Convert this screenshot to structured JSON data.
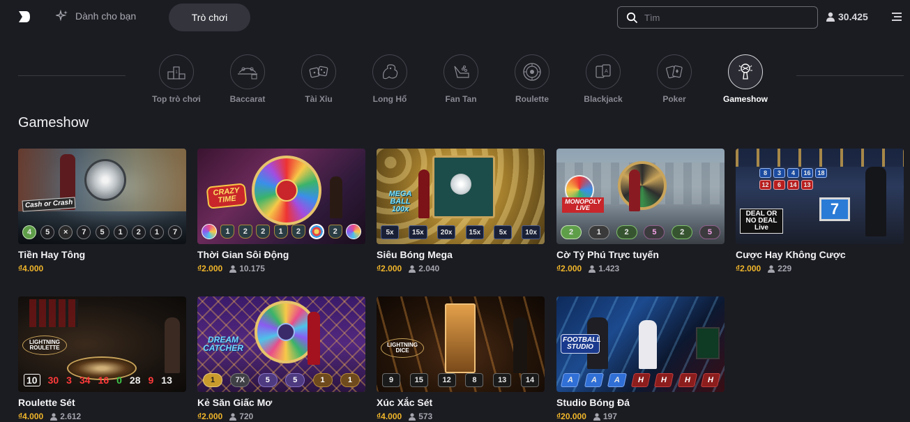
{
  "header": {
    "nav_for_you": "Dành cho bạn",
    "nav_games": "Trò chơi",
    "search_placeholder": "Tìm",
    "online_count": "30.425"
  },
  "categories": [
    {
      "label": "Top trò chơi",
      "icon": "podium-icon",
      "active": false
    },
    {
      "label": "Baccarat",
      "icon": "baccarat-table-icon",
      "active": false
    },
    {
      "label": "Tài Xỉu",
      "icon": "dice-icon",
      "active": false
    },
    {
      "label": "Long Hổ",
      "icon": "dragon-tiger-icon",
      "active": false
    },
    {
      "label": "Fan Tan",
      "icon": "fan-tan-hand-icon",
      "active": false
    },
    {
      "label": "Roulette",
      "icon": "roulette-wheel-icon",
      "active": false
    },
    {
      "label": "Blackjack",
      "icon": "blackjack-cards-icon",
      "active": false
    },
    {
      "label": "Poker",
      "icon": "poker-cards-icon",
      "active": false
    },
    {
      "label": "Gameshow",
      "icon": "microphone-icon",
      "active": true
    }
  ],
  "section_title": "Gameshow",
  "games": [
    {
      "name": "Tiền Hay Tông",
      "price": "₫4.000",
      "viewers": "",
      "logo_text": "Cash or Crash",
      "results": [
        "4",
        "5",
        "×",
        "7",
        "5",
        "1",
        "2",
        "1",
        "7"
      ]
    },
    {
      "name": "Thời Gian Sôi Động",
      "price": "₫2.000",
      "viewers": "10.175",
      "logo_text": "CRAZY TIME",
      "results": [
        "1",
        "2",
        "2",
        "1",
        "2",
        "2"
      ]
    },
    {
      "name": "Siêu Bóng Mega",
      "price": "₫2.000",
      "viewers": "2.040",
      "logo_text": "MEGA BALL 100x",
      "results": [
        "5x",
        "15x",
        "20x",
        "15x",
        "5x",
        "10x"
      ]
    },
    {
      "name": "Cờ Tỷ Phú Trực tuyến",
      "price": "₫2.000",
      "viewers": "1.423",
      "logo_text": "MONOPOLY LIVE",
      "results": [
        "2",
        "1",
        "2",
        "5",
        "2",
        "5"
      ]
    },
    {
      "name": "Cược Hay Không Cược",
      "price": "₫2.000",
      "viewers": "229",
      "logo_text": "DEAL OR NO DEAL Live",
      "screen_numbers": [
        "8",
        "3",
        "4",
        "16",
        "18",
        "12",
        "6",
        "14",
        "13"
      ],
      "big_number": "7",
      "results": []
    },
    {
      "name": "Roulette Sét",
      "price": "₫4.000",
      "viewers": "2.612",
      "logo_text": "LIGHTNING ROULETTE",
      "results": [
        "10",
        "30",
        "3",
        "34",
        "16",
        "0",
        "28",
        "9",
        "13"
      ]
    },
    {
      "name": "Kẻ Săn Giấc Mơ",
      "price": "₫2.000",
      "viewers": "720",
      "logo_text": "DREAM CATCHER",
      "results": [
        "1",
        "7X",
        "5",
        "5",
        "1",
        "1"
      ]
    },
    {
      "name": "Xúc Xắc Sét",
      "price": "₫4.000",
      "viewers": "573",
      "logo_text": "LIGHTNING DICE",
      "results": [
        "9",
        "15",
        "12",
        "8",
        "13",
        "14"
      ]
    },
    {
      "name": "Studio Bóng Đá",
      "price": "₫20.000",
      "viewers": "197",
      "logo_text": "FOOTBALL STUDIO",
      "results": [
        "A",
        "A",
        "A",
        "H",
        "H",
        "H",
        "H"
      ]
    }
  ],
  "colors": {
    "background": "#1b1c22",
    "price": "#f1b62a",
    "active_tab": "#33343c"
  }
}
